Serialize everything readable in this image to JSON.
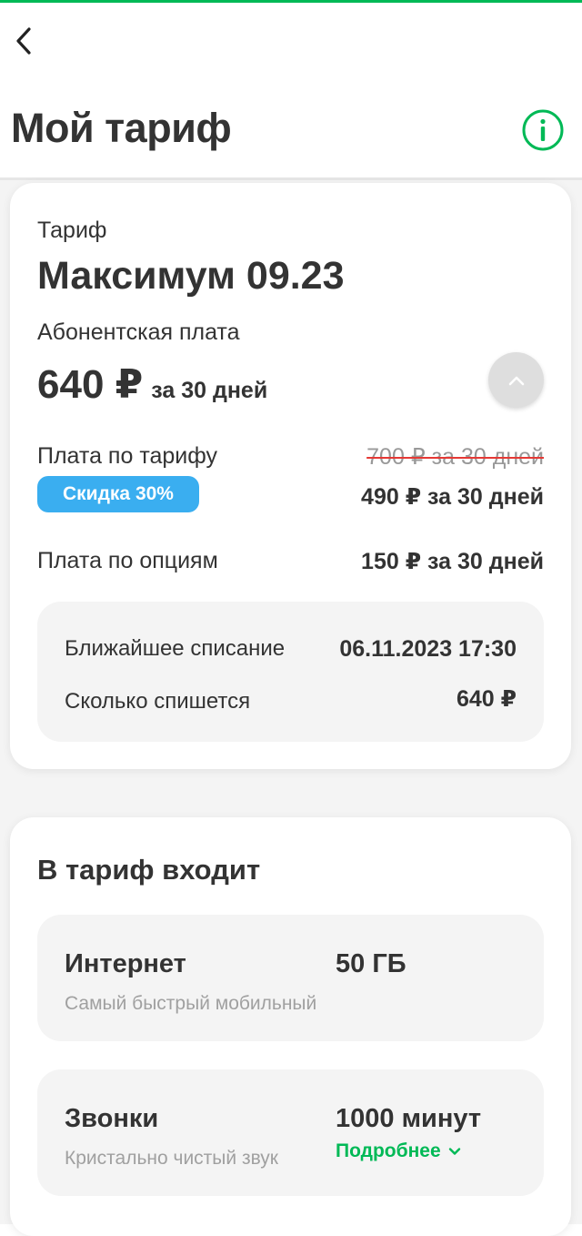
{
  "header": {
    "title": "Мой тариф"
  },
  "tariff": {
    "label": "Тариф",
    "name": "Максимум 09.23",
    "fee_label": "Абонентская плата",
    "fee_amount": "640 ₽",
    "fee_period": "за 30 дней",
    "plan_fee_label": "Плата по тарифу",
    "plan_fee_old": "700 ₽ за 30 дней",
    "plan_fee_new": "490 ₽ за 30 дней",
    "discount_badge": "Скидка 30%",
    "options_fee_label": "Плата по опциям",
    "options_fee_value": "150 ₽ за 30 дней",
    "next_charge_label": "Ближайшее списание",
    "next_charge_value": "06.11.2023 17:30",
    "charge_amount_label": "Сколько спишется",
    "charge_amount_value": "640 ₽"
  },
  "included": {
    "title": "В тариф входит",
    "items": [
      {
        "name": "Интернет",
        "subtitle": "Самый быстрый мобильный",
        "value": "50 ГБ"
      },
      {
        "name": "Звонки",
        "subtitle": "Кристально чистый звук",
        "value": "1000 минут",
        "link": "Подробнее"
      }
    ]
  },
  "colors": {
    "accent": "#00b956",
    "discount": "#3aaef0",
    "strike": "#e53935"
  },
  "icons": {
    "back": "chevron-left-icon",
    "info": "info-icon",
    "collapse": "chevron-up-icon",
    "more": "chevron-down-icon"
  }
}
